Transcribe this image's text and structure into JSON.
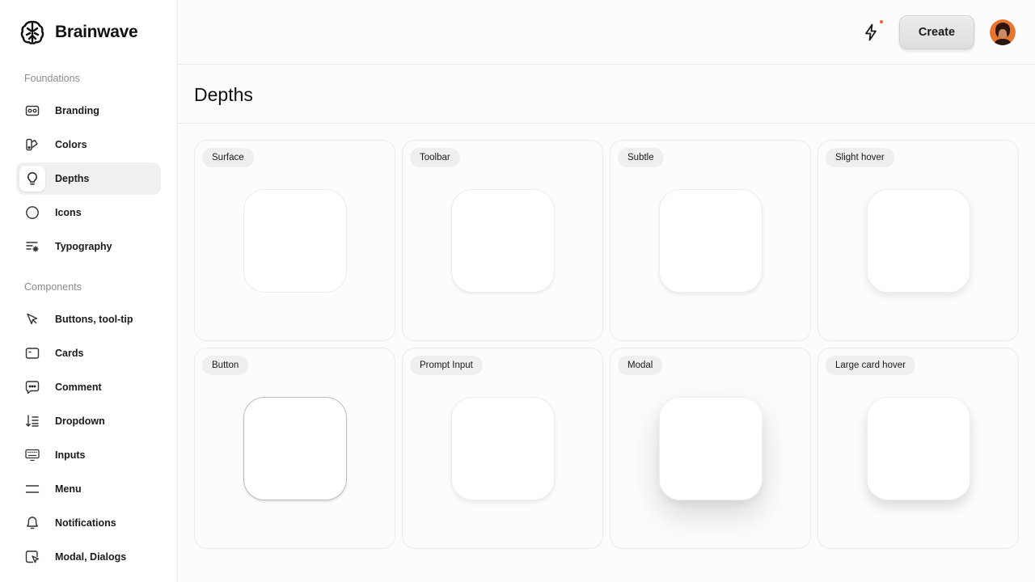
{
  "brand": {
    "name": "Brainwave",
    "logo_icon": "brain-logo-icon"
  },
  "sidebar": {
    "sections": [
      {
        "label": "Foundations",
        "items": [
          {
            "label": "Branding",
            "icon": "id-card-icon"
          },
          {
            "label": "Colors",
            "icon": "palette-icon"
          },
          {
            "label": "Depths",
            "icon": "lightbulb-icon",
            "active": true
          },
          {
            "label": "Icons",
            "icon": "circle-icon"
          },
          {
            "label": "Typography",
            "icon": "text-sparkle-icon"
          }
        ]
      },
      {
        "label": "Components",
        "items": [
          {
            "label": "Buttons, tool-tip",
            "icon": "cursor-icon"
          },
          {
            "label": "Cards",
            "icon": "card-icon"
          },
          {
            "label": "Comment",
            "icon": "chat-bubble-icon"
          },
          {
            "label": "Dropdown",
            "icon": "sort-list-icon"
          },
          {
            "label": "Inputs",
            "icon": "keyboard-icon"
          },
          {
            "label": "Menu",
            "icon": "menu-icon"
          },
          {
            "label": "Notifications",
            "icon": "bell-icon"
          },
          {
            "label": "Modal, Dialogs",
            "icon": "window-cursor-icon"
          }
        ]
      }
    ]
  },
  "header": {
    "create_label": "Create",
    "notification_icon": "bolt-icon",
    "accent_dot_color": "#ff5a3c"
  },
  "page": {
    "title": "Depths"
  },
  "depths": [
    {
      "label": "Surface"
    },
    {
      "label": "Toolbar"
    },
    {
      "label": "Subtle"
    },
    {
      "label": "Slight hover"
    },
    {
      "label": "Button"
    },
    {
      "label": "Prompt Input"
    },
    {
      "label": "Modal"
    },
    {
      "label": "Large card hover"
    }
  ]
}
